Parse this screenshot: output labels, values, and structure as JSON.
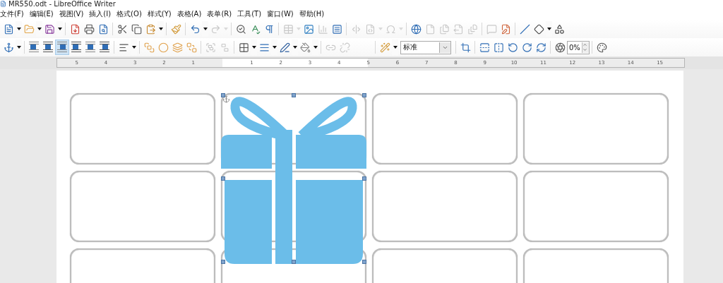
{
  "window": {
    "title": "MR550.odt - LibreOffice Writer"
  },
  "menu": [
    "文件(F)",
    "编辑(E)",
    "视图(V)",
    "插入(I)",
    "格式(O)",
    "样式(Y)",
    "表格(A)",
    "表单(R)",
    "工具(T)",
    "窗口(W)",
    "帮助(H)"
  ],
  "toolbar_1": [
    {
      "kind": "new",
      "disabled": false
    },
    {
      "kind": "dropdown",
      "disabled": false
    },
    {
      "kind": "open",
      "disabled": false
    },
    {
      "kind": "dropdown",
      "disabled": false
    },
    {
      "kind": "save",
      "disabled": false
    },
    {
      "kind": "dropdown",
      "disabled": false
    },
    {
      "kind": "separator"
    },
    {
      "kind": "pdf",
      "disabled": false
    },
    {
      "kind": "print",
      "disabled": false
    },
    {
      "kind": "preview",
      "disabled": false
    },
    {
      "kind": "separator"
    },
    {
      "kind": "cut",
      "disabled": false
    },
    {
      "kind": "copy",
      "disabled": false
    },
    {
      "kind": "paste",
      "disabled": false
    },
    {
      "kind": "dropdown",
      "disabled": false
    },
    {
      "kind": "separator"
    },
    {
      "kind": "clone",
      "disabled": false
    },
    {
      "kind": "separator"
    },
    {
      "kind": "undo",
      "disabled": false
    },
    {
      "kind": "dropdown",
      "disabled": false
    },
    {
      "kind": "redo",
      "disabled": true
    },
    {
      "kind": "dropdown",
      "disabled": true
    },
    {
      "kind": "separator"
    },
    {
      "kind": "find",
      "disabled": false
    },
    {
      "kind": "spell",
      "disabled": false
    },
    {
      "kind": "pilcrow",
      "disabled": false
    },
    {
      "kind": "separator"
    },
    {
      "kind": "table",
      "disabled": true
    },
    {
      "kind": "dropdown",
      "disabled": true
    },
    {
      "kind": "image",
      "disabled": false
    },
    {
      "kind": "chart",
      "disabled": true
    },
    {
      "kind": "textbox",
      "disabled": false
    },
    {
      "kind": "separator"
    },
    {
      "kind": "pagebreak",
      "disabled": true
    },
    {
      "kind": "field",
      "disabled": true
    },
    {
      "kind": "dropdown",
      "disabled": true
    },
    {
      "kind": "omega",
      "disabled": true
    },
    {
      "kind": "dropdown",
      "disabled": true
    },
    {
      "kind": "separator"
    },
    {
      "kind": "hyperlink",
      "disabled": false
    },
    {
      "kind": "footnote",
      "disabled": true
    },
    {
      "kind": "endnote",
      "disabled": true
    },
    {
      "kind": "bookmark",
      "disabled": true
    },
    {
      "kind": "crossref",
      "disabled": true
    },
    {
      "kind": "separator"
    },
    {
      "kind": "comment",
      "disabled": true
    },
    {
      "kind": "track",
      "disabled": false
    },
    {
      "kind": "separator"
    },
    {
      "kind": "line",
      "disabled": false
    },
    {
      "kind": "shape",
      "disabled": false
    },
    {
      "kind": "dropdown",
      "disabled": false
    },
    {
      "kind": "shapes",
      "disabled": false
    }
  ],
  "toolbar_2": [
    {
      "kind": "anchor",
      "disabled": false
    },
    {
      "kind": "dropdown",
      "disabled": false
    },
    {
      "kind": "separator"
    },
    {
      "kind": "wrap",
      "selected": false
    },
    {
      "kind": "wrap",
      "selected": false
    },
    {
      "kind": "wrap",
      "selected": true
    },
    {
      "kind": "wrap",
      "selected": false
    },
    {
      "kind": "wrap",
      "selected": false
    },
    {
      "kind": "wrap",
      "selected": false
    },
    {
      "kind": "separator"
    },
    {
      "kind": "align",
      "disabled": false
    },
    {
      "kind": "dropdown",
      "disabled": false
    },
    {
      "kind": "separator"
    },
    {
      "kind": "front",
      "disabled": false
    },
    {
      "kind": "forward",
      "disabled": false
    },
    {
      "kind": "backward",
      "disabled": false
    },
    {
      "kind": "back",
      "disabled": false
    },
    {
      "kind": "separator"
    },
    {
      "kind": "group",
      "disabled": true
    },
    {
      "kind": "ungroup",
      "disabled": true
    },
    {
      "kind": "separator"
    },
    {
      "kind": "borders",
      "disabled": false
    },
    {
      "kind": "dropdown",
      "disabled": false
    },
    {
      "kind": "linestyle",
      "disabled": false
    },
    {
      "kind": "dropdown",
      "disabled": false
    },
    {
      "kind": "linecolor",
      "disabled": false
    },
    {
      "kind": "dropdown",
      "disabled": false
    },
    {
      "kind": "fill",
      "disabled": false
    },
    {
      "kind": "dropdown",
      "disabled": false
    },
    {
      "kind": "separator"
    },
    {
      "kind": "link",
      "disabled": true
    },
    {
      "kind": "unlink",
      "disabled": true
    },
    {
      "kind": "spacer"
    },
    {
      "kind": "separator"
    },
    {
      "kind": "filter",
      "disabled": false
    },
    {
      "kind": "dropdown",
      "disabled": false
    },
    {
      "kind": "select",
      "value": "标准"
    },
    {
      "kind": "separator"
    },
    {
      "kind": "crop",
      "disabled": false
    },
    {
      "kind": "separator"
    },
    {
      "kind": "flipv",
      "disabled": false
    },
    {
      "kind": "fliph",
      "disabled": false
    },
    {
      "kind": "rotleft",
      "disabled": false
    },
    {
      "kind": "rotright",
      "disabled": false
    },
    {
      "kind": "rotate",
      "disabled": false
    },
    {
      "kind": "separator"
    },
    {
      "kind": "transparency",
      "disabled": false
    },
    {
      "kind": "spin",
      "value": "0%"
    },
    {
      "kind": "separator"
    },
    {
      "kind": "palette",
      "disabled": false
    }
  ],
  "ruler": {
    "left_marks": [
      "5",
      "4",
      "3",
      "2",
      "1"
    ],
    "right_marks": [
      "1",
      "2",
      "3",
      "4",
      "5",
      "6",
      "7",
      "8",
      "9",
      "10",
      "11",
      "12",
      "13",
      "14",
      "15"
    ]
  },
  "page": {
    "gift_image": {
      "selected": true,
      "color": "#6bbde9"
    }
  }
}
